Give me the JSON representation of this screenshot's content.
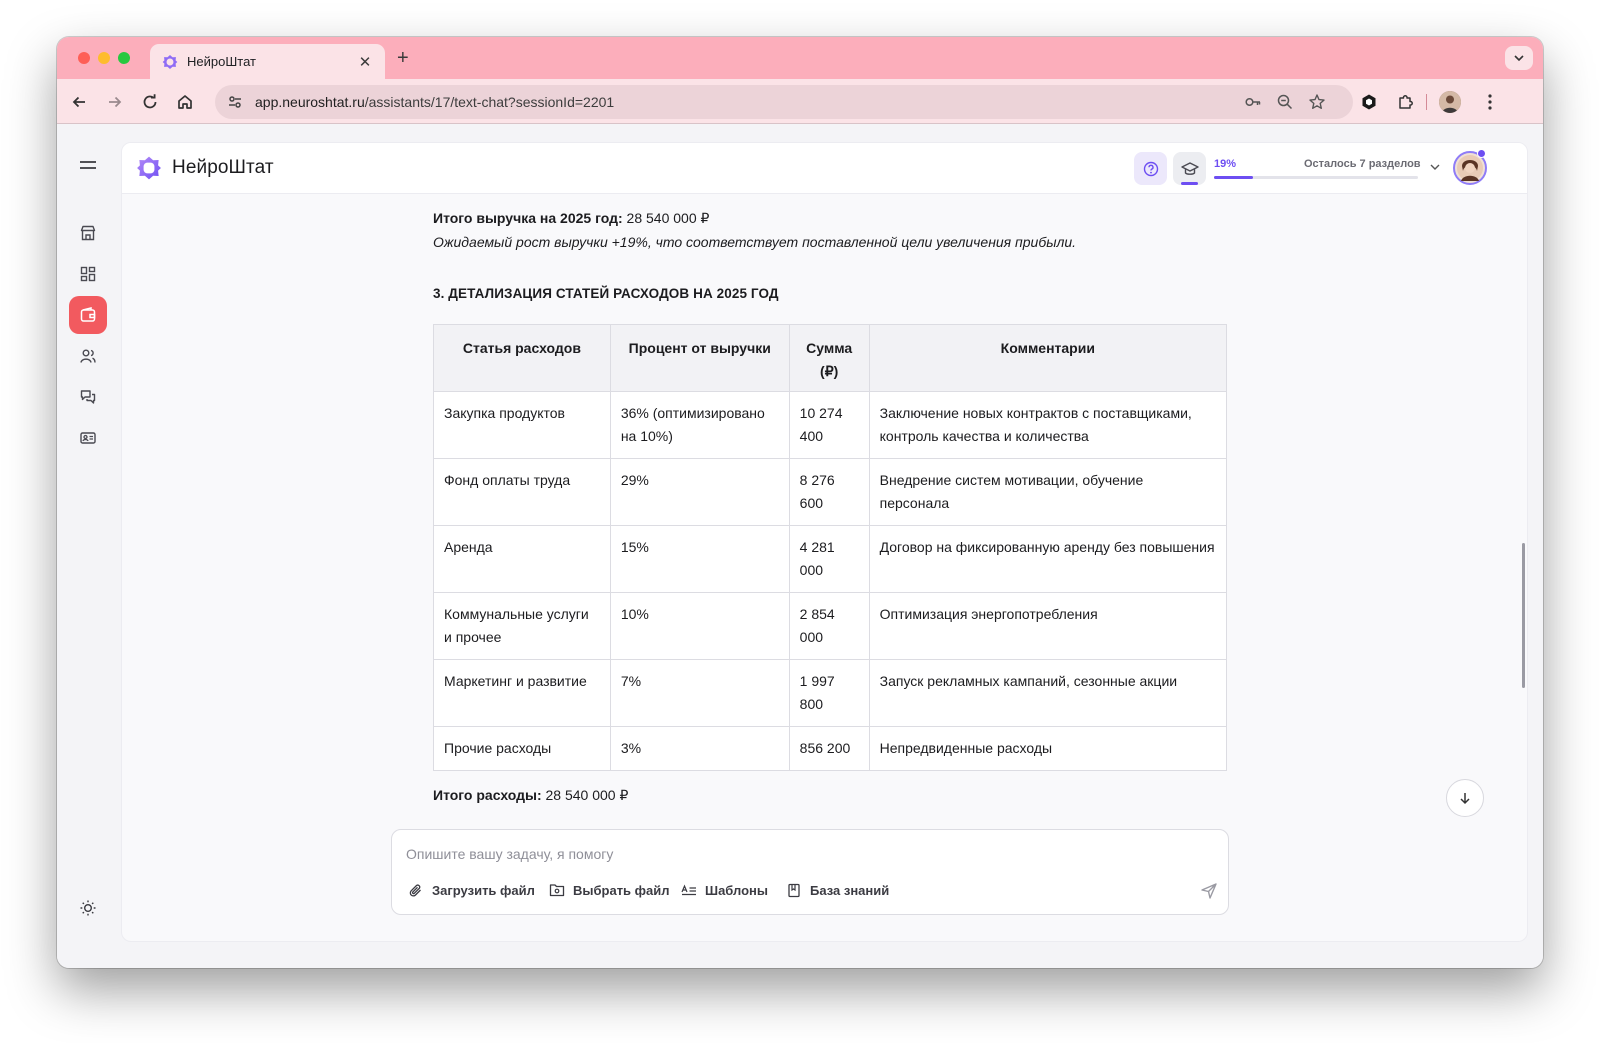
{
  "browser": {
    "tab_title": "НейроШтат",
    "url_host": "app.neuroshtat.ru",
    "url_path": "/assistants/17/text-chat?sessionId=2201"
  },
  "app": {
    "brand": "НейроШтат",
    "progress_percent_label": "19%",
    "progress_fraction": 0.19,
    "progress_remaining": "Осталось 7 разделов",
    "accent_color": "#6d4ef2",
    "active_nav_color": "#f25a5f"
  },
  "sidebar": {
    "items": [
      {
        "icon": "store-icon"
      },
      {
        "icon": "dashboard-icon"
      },
      {
        "icon": "wallet-icon",
        "active": true
      },
      {
        "icon": "users-icon"
      },
      {
        "icon": "chat-icon"
      },
      {
        "icon": "id-card-icon"
      }
    ],
    "bottom_icon": "sun-icon"
  },
  "message": {
    "total_revenue_label": "Итого выручка на 2025 год:",
    "total_revenue_value": " 28 540 000 ₽",
    "growth_note": "Ожидаемый рост выручки +19%, что соответствует поставленной цели увеличения прибыли.",
    "section_title": "3. ДЕТАЛИЗАЦИЯ СТАТЕЙ РАСХОДОВ НА 2025 ГОД",
    "table": {
      "headers": [
        "Статья расходов",
        "Процент от выручки",
        "Сумма (₽)",
        "Комментарии"
      ],
      "rows": [
        [
          "Закупка продуктов",
          "36% (оптимизировано на 10%)",
          "10 274 400",
          "Заключение новых контрактов с поставщиками, контроль качества и количества"
        ],
        [
          "Фонд оплаты труда",
          "29%",
          "8 276 600",
          "Внедрение систем мотивации, обучение персонала"
        ],
        [
          "Аренда",
          "15%",
          "4 281 000",
          "Договор на фиксированную аренду без повышения"
        ],
        [
          "Коммунальные услуги и прочее",
          "10%",
          "2 854 000",
          "Оптимизация энергопотребления"
        ],
        [
          "Маркетинг и развитие",
          "7%",
          "1 997 800",
          "Запуск рекламных кампаний, сезонные акции"
        ],
        [
          "Прочие расходы",
          "3%",
          "856 200",
          "Непредвиденные расходы"
        ]
      ]
    },
    "total_expense_label": "Итого расходы:",
    "total_expense_value": " 28 540 000 ₽"
  },
  "composer": {
    "placeholder": "Опишите вашу задачу, я помогу",
    "value": "",
    "upload_label": "Загрузить файл",
    "choose_label": "Выбрать файл",
    "templates_label": "Шаблоны",
    "knowledge_label": "База знаний"
  }
}
